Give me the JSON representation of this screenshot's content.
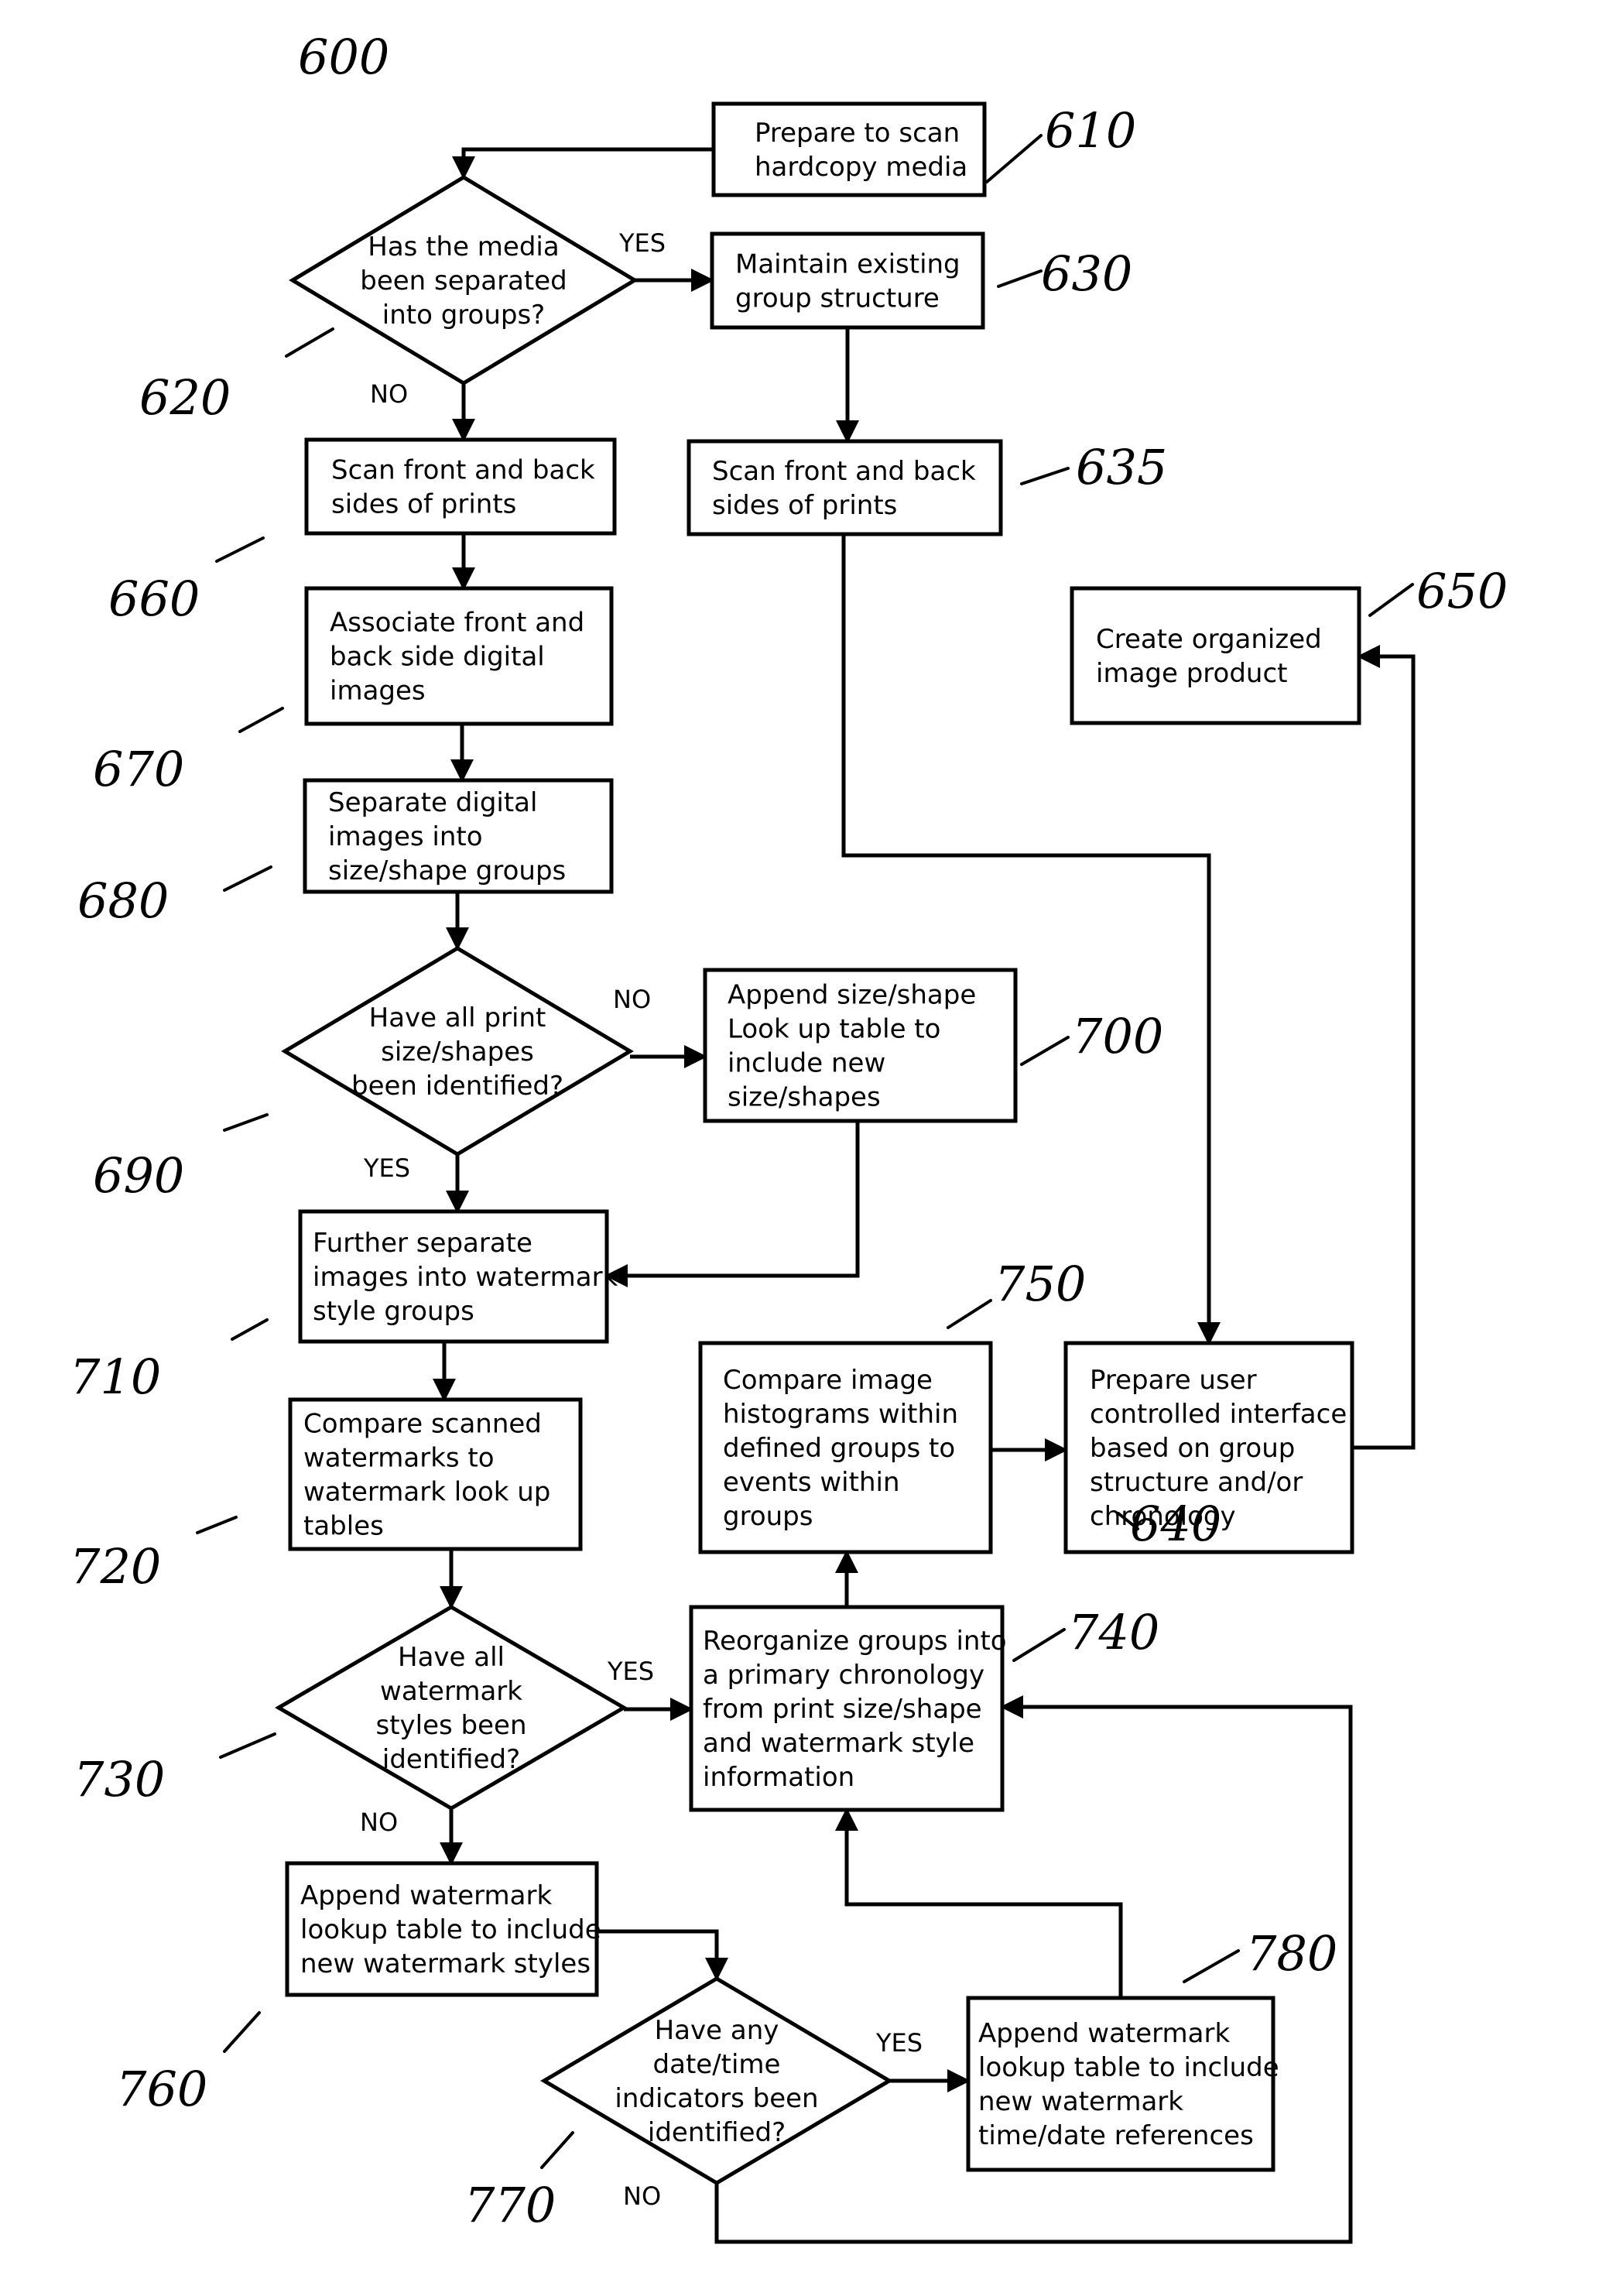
{
  "figure": {
    "reference": "600",
    "nodes": [
      {
        "id": "610",
        "type": "process",
        "lines": [
          "Prepare to scan",
          "hardcopy media"
        ]
      },
      {
        "id": "620",
        "type": "decision",
        "lines": [
          "Has the media",
          "been separated",
          "into groups?"
        ]
      },
      {
        "id": "630",
        "type": "process",
        "lines": [
          "Maintain existing",
          "group structure"
        ]
      },
      {
        "id": "635",
        "type": "process",
        "lines": [
          "Scan front and back",
          "sides of prints"
        ]
      },
      {
        "id": "660",
        "type": "process",
        "lines": [
          "Scan front and back",
          "sides of prints"
        ]
      },
      {
        "id": "650",
        "type": "process",
        "lines": [
          "Create organized",
          "image product"
        ]
      },
      {
        "id": "670",
        "type": "process",
        "lines": [
          "Associate front and",
          "back side digital",
          "images"
        ]
      },
      {
        "id": "680",
        "type": "process",
        "lines": [
          "Separate digital",
          "images into",
          "size/shape groups"
        ]
      },
      {
        "id": "690",
        "type": "decision",
        "lines": [
          "Have all print",
          "size/shapes",
          "been identified?"
        ]
      },
      {
        "id": "700",
        "type": "process",
        "lines": [
          "Append size/shape",
          "Look up table to",
          "include new",
          "size/shapes"
        ]
      },
      {
        "id": "710",
        "type": "process",
        "lines": [
          "Further separate",
          "images into watermark",
          "style groups"
        ]
      },
      {
        "id": "750",
        "type": "process",
        "lines": [
          "Compare image",
          "histograms within",
          "defined groups to",
          "events within",
          "groups"
        ]
      },
      {
        "id": "640",
        "type": "process",
        "lines": [
          "Prepare user",
          "controlled interface",
          "based on group",
          "structure and/or",
          "chronology"
        ]
      },
      {
        "id": "720",
        "type": "process",
        "lines": [
          "Compare scanned",
          "watermarks to",
          "watermark look up",
          "tables"
        ]
      },
      {
        "id": "730",
        "type": "decision",
        "lines": [
          "Have all",
          "watermark",
          "styles been",
          "identified?"
        ]
      },
      {
        "id": "740",
        "type": "process",
        "lines": [
          "Reorganize groups into",
          "a primary chronology",
          "from print size/shape",
          "and watermark style",
          "information"
        ]
      },
      {
        "id": "760",
        "type": "process",
        "lines": [
          "Append watermark",
          "lookup table to include",
          "new watermark styles"
        ]
      },
      {
        "id": "770",
        "type": "decision",
        "lines": [
          "Have any",
          "date/time",
          "indicators been",
          "identified?"
        ]
      },
      {
        "id": "780",
        "type": "process",
        "lines": [
          "Append watermark",
          "lookup table to include",
          "new watermark",
          "time/date references"
        ]
      }
    ],
    "edges": [
      {
        "from": "610",
        "to": "620",
        "label": ""
      },
      {
        "from": "620",
        "to": "630",
        "label": "YES"
      },
      {
        "from": "620",
        "to": "660",
        "label": "NO"
      },
      {
        "from": "630",
        "to": "635",
        "label": ""
      },
      {
        "from": "635",
        "to": "640",
        "label": ""
      },
      {
        "from": "660",
        "to": "670",
        "label": ""
      },
      {
        "from": "670",
        "to": "680",
        "label": ""
      },
      {
        "from": "680",
        "to": "690",
        "label": ""
      },
      {
        "from": "690",
        "to": "700",
        "label": "NO"
      },
      {
        "from": "690",
        "to": "710",
        "label": "YES"
      },
      {
        "from": "700",
        "to": "710",
        "label": ""
      },
      {
        "from": "710",
        "to": "720",
        "label": ""
      },
      {
        "from": "720",
        "to": "730",
        "label": ""
      },
      {
        "from": "730",
        "to": "740",
        "label": "YES"
      },
      {
        "from": "730",
        "to": "760",
        "label": "NO"
      },
      {
        "from": "740",
        "to": "750",
        "label": ""
      },
      {
        "from": "750",
        "to": "640",
        "label": ""
      },
      {
        "from": "640",
        "to": "650",
        "label": ""
      },
      {
        "from": "760",
        "to": "770",
        "label": ""
      },
      {
        "from": "770",
        "to": "780",
        "label": "YES"
      },
      {
        "from": "770",
        "to": "740",
        "label": "NO"
      },
      {
        "from": "780",
        "to": "740",
        "label": ""
      }
    ],
    "edge_labels": {
      "yes": "YES",
      "no": "NO"
    }
  }
}
